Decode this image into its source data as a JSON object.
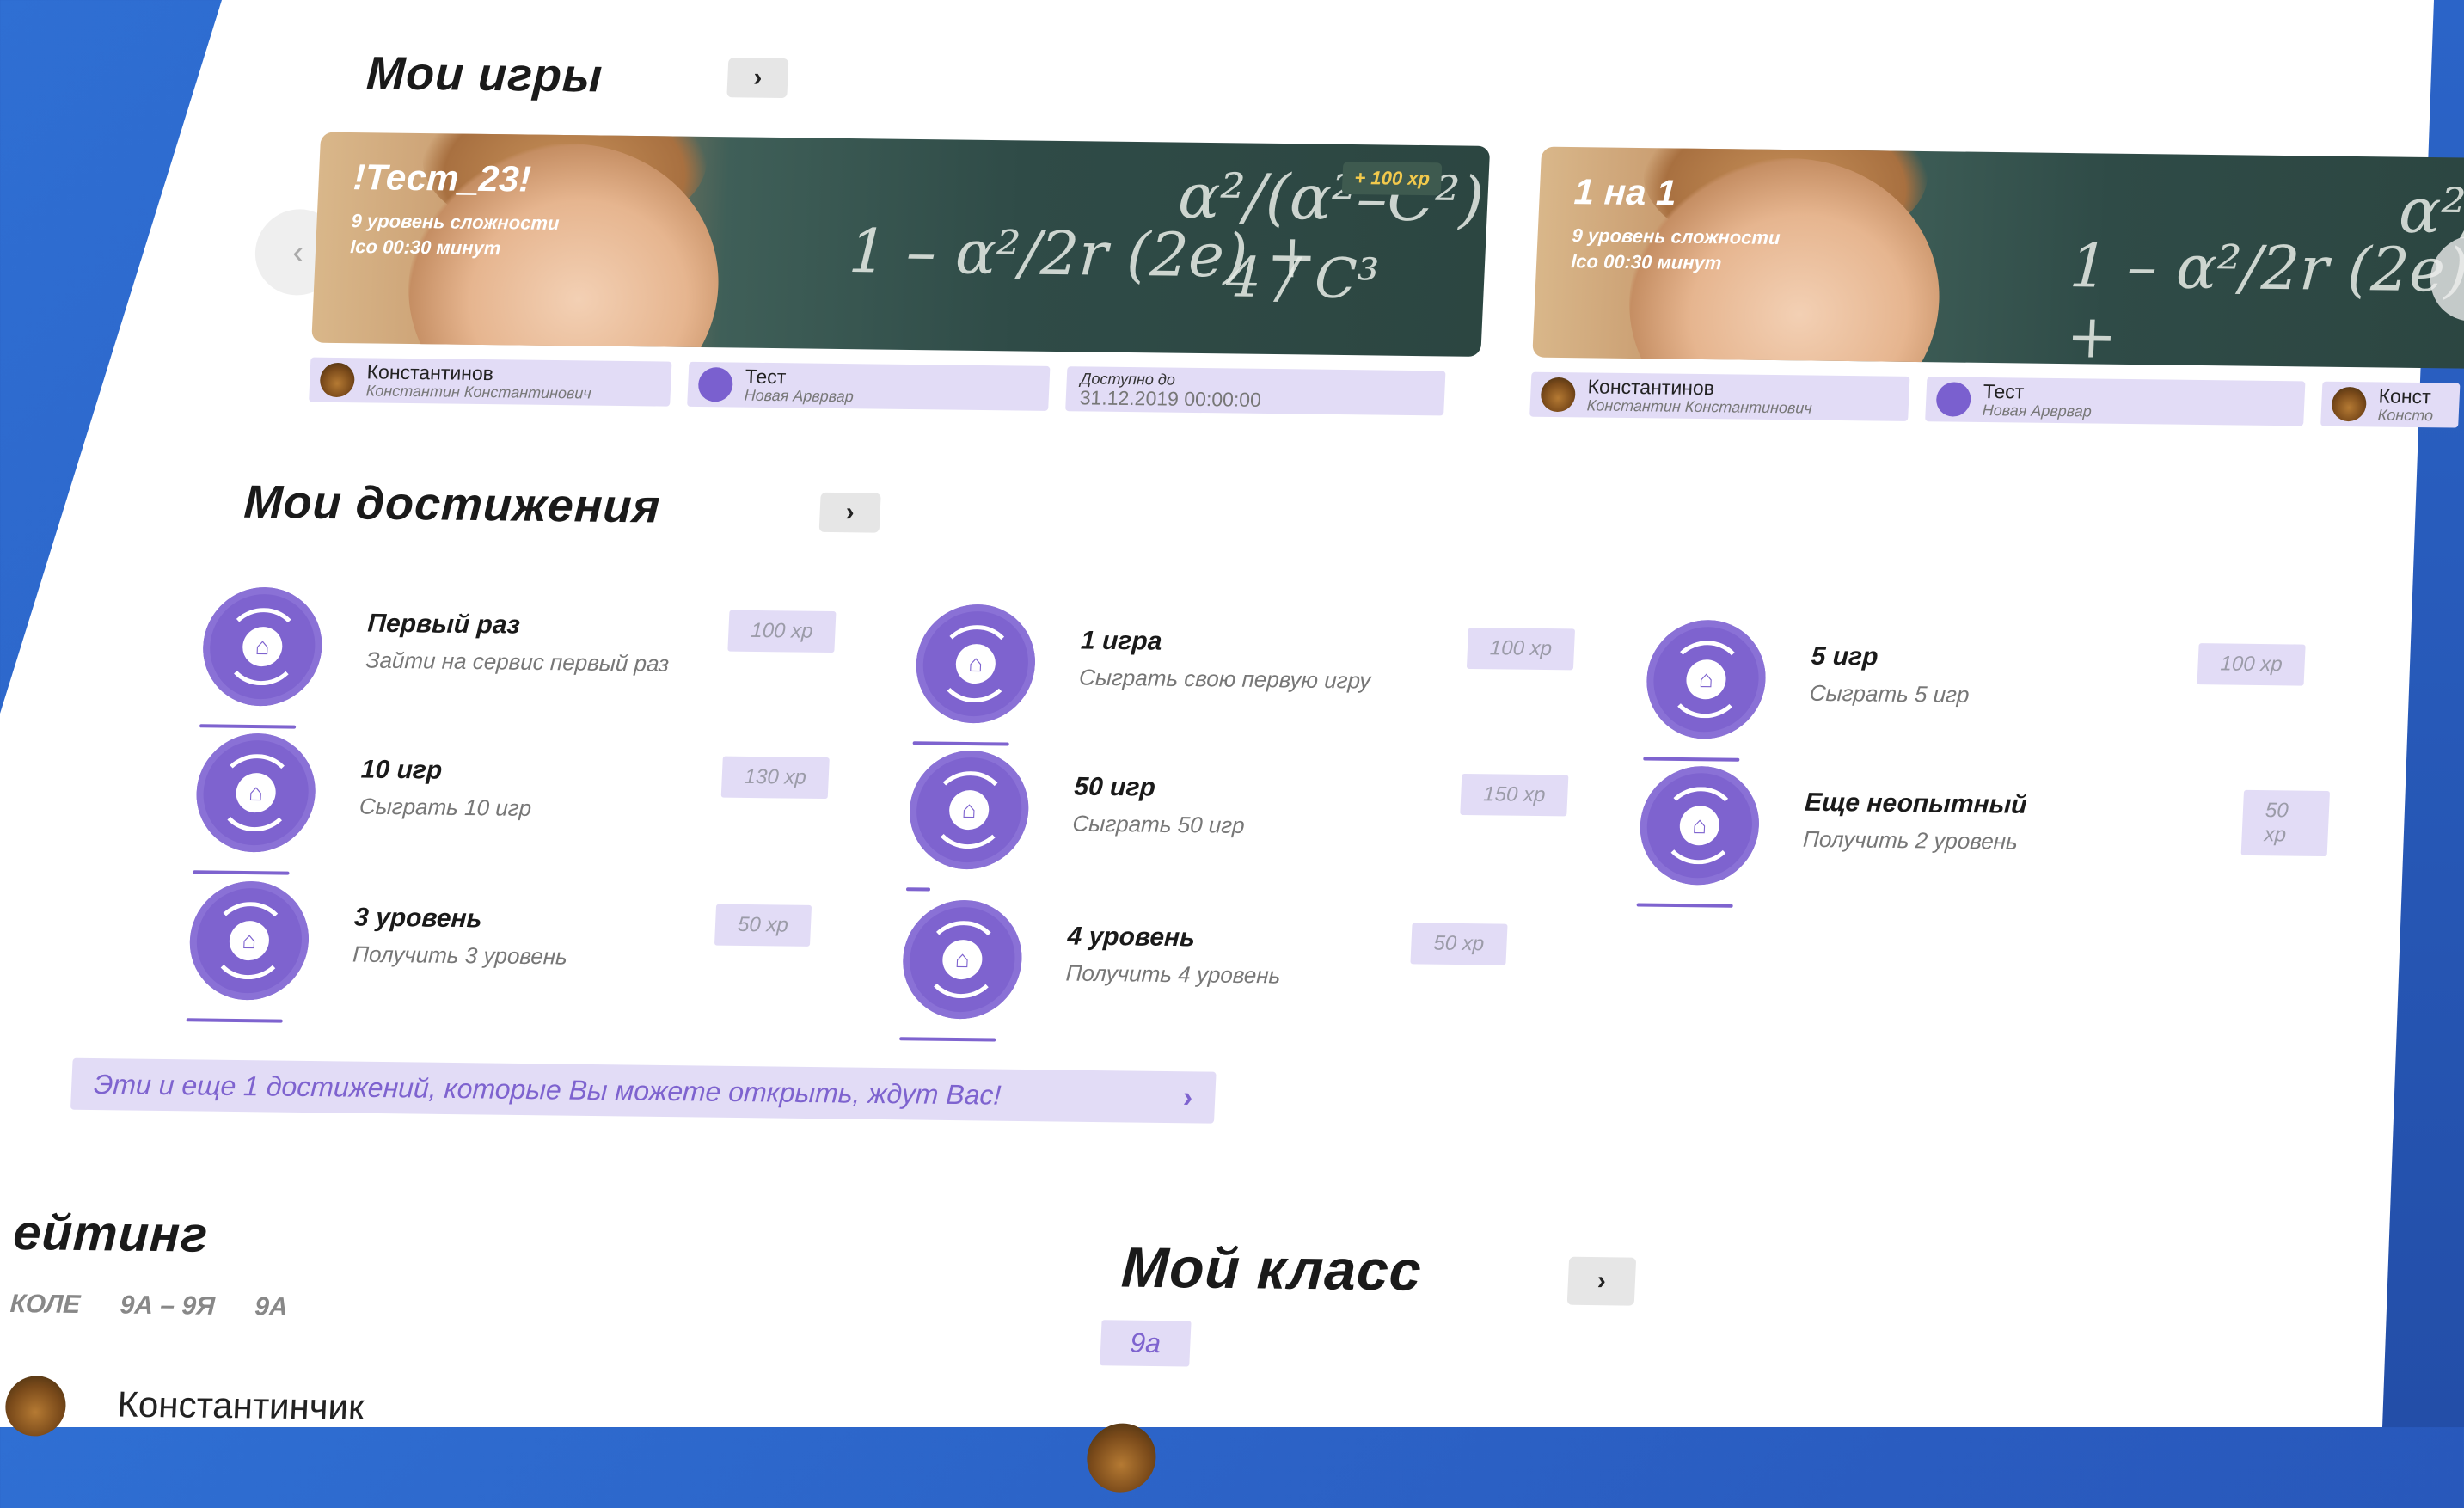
{
  "games_section": {
    "title": "Мои игры",
    "arrow": "›"
  },
  "games": [
    {
      "title": "!Тест_23!",
      "difficulty": "9 уровень сложности",
      "time": "Ico  00:30 минут",
      "xp": "+ 100 xp",
      "author_name": "Константинов",
      "author_full": "Константин Константинович",
      "game_name": "Тест",
      "game_sub": "Новая Арврвар",
      "deadline_label": "Доступно до",
      "deadline": "31.12.2019 00:00:00"
    },
    {
      "title": "1 на 1",
      "difficulty": "9 уровень сложности",
      "time": "Ico  00:30 минут",
      "author_name": "Константинов",
      "author_full": "Константин Константинович",
      "game_name": "Тест",
      "game_sub": "Новая Арврвар",
      "third_name": "Конст",
      "third_sub": "Консто"
    }
  ],
  "nav": {
    "prev": "‹",
    "next": "›"
  },
  "achievements_section": {
    "title": "Мои достижения",
    "arrow": "›"
  },
  "achievements": [
    {
      "title": "Первый раз",
      "desc": "Зайти на сервис первый раз",
      "xp": "100 xp"
    },
    {
      "title": "1 игра",
      "desc": "Сыграть свою первую игру",
      "xp": "100 xp"
    },
    {
      "title": "5 игр",
      "desc": "Сыграть 5 игр",
      "xp": "100 xp"
    },
    {
      "title": "10 игр",
      "desc": "Сыграть 10 игр",
      "xp": "130 xp"
    },
    {
      "title": "50 игр",
      "desc": "Сыграть 50 игр",
      "xp": "150 xp"
    },
    {
      "title": "Еще неопытный",
      "desc": "Получить 2 уровень",
      "xp": "50 xp"
    },
    {
      "title": "3 уровень",
      "desc": "Получить 3 уровень",
      "xp": "50 xp"
    },
    {
      "title": "4 уровень",
      "desc": "Получить 4 уровень",
      "xp": "50 xp"
    }
  ],
  "more_achievements": {
    "text": "Эти и еще 1 достижений, которые Вы можете открыть, ждут Вас!",
    "arrow": "›"
  },
  "rating": {
    "title": "ейтинг",
    "tabs": [
      "КОЛЕ",
      "9А – 9Я",
      "9А"
    ],
    "first_name": "Константинчик"
  },
  "my_class": {
    "title": "Мой класс",
    "arrow": "›",
    "class_tag": "9а"
  }
}
